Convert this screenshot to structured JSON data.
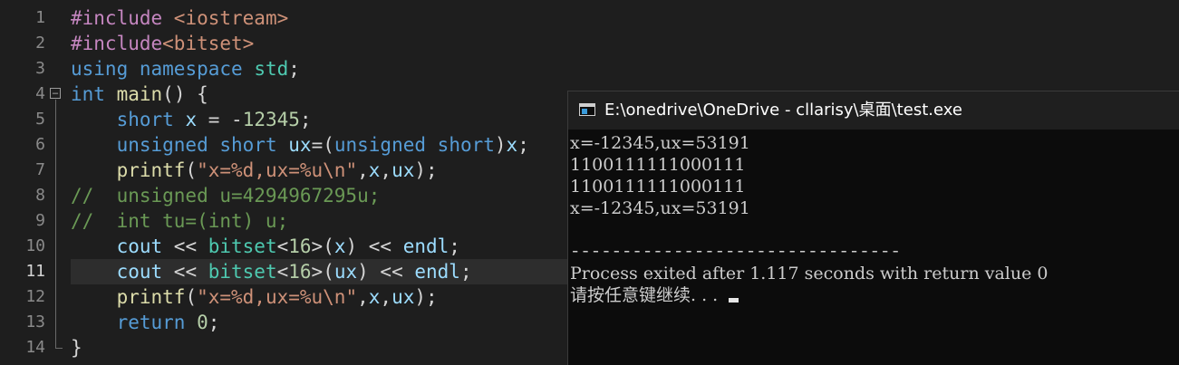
{
  "editor": {
    "line_numbers": [
      "1",
      "2",
      "3",
      "4",
      "5",
      "6",
      "7",
      "8",
      "9",
      "10",
      "11",
      "12",
      "13",
      "14"
    ],
    "fold_marker": "−",
    "lines": [
      [
        {
          "t": "#include ",
          "c": "pp"
        },
        {
          "t": "<iostream>",
          "c": "str"
        }
      ],
      [
        {
          "t": "#include",
          "c": "pp"
        },
        {
          "t": "<bitset>",
          "c": "str"
        }
      ],
      [
        {
          "t": "using",
          "c": "kw"
        },
        {
          "t": " ",
          "c": "op"
        },
        {
          "t": "namespace",
          "c": "kw"
        },
        {
          "t": " ",
          "c": "op"
        },
        {
          "t": "std",
          "c": "ty"
        },
        {
          "t": ";",
          "c": "op"
        }
      ],
      [
        {
          "t": "int",
          "c": "kw"
        },
        {
          "t": " ",
          "c": "op"
        },
        {
          "t": "main",
          "c": "fn"
        },
        {
          "t": "() {",
          "c": "op"
        }
      ],
      [
        {
          "t": "    ",
          "c": "op"
        },
        {
          "t": "short",
          "c": "kw"
        },
        {
          "t": " ",
          "c": "op"
        },
        {
          "t": "x",
          "c": "id"
        },
        {
          "t": " = -",
          "c": "op"
        },
        {
          "t": "12345",
          "c": "num"
        },
        {
          "t": ";",
          "c": "op"
        }
      ],
      [
        {
          "t": "    ",
          "c": "op"
        },
        {
          "t": "unsigned",
          "c": "kw"
        },
        {
          "t": " ",
          "c": "op"
        },
        {
          "t": "short",
          "c": "kw"
        },
        {
          "t": " ",
          "c": "op"
        },
        {
          "t": "ux",
          "c": "id"
        },
        {
          "t": "=(",
          "c": "op"
        },
        {
          "t": "unsigned",
          "c": "kw"
        },
        {
          "t": " ",
          "c": "op"
        },
        {
          "t": "short",
          "c": "kw"
        },
        {
          "t": ")",
          "c": "op"
        },
        {
          "t": "x",
          "c": "id"
        },
        {
          "t": ";",
          "c": "op"
        }
      ],
      [
        {
          "t": "    ",
          "c": "op"
        },
        {
          "t": "printf",
          "c": "fn"
        },
        {
          "t": "(",
          "c": "op"
        },
        {
          "t": "\"x=%d,ux=%u\\n\"",
          "c": "str"
        },
        {
          "t": ",",
          "c": "op"
        },
        {
          "t": "x",
          "c": "id"
        },
        {
          "t": ",",
          "c": "op"
        },
        {
          "t": "ux",
          "c": "id"
        },
        {
          "t": ");",
          "c": "op"
        }
      ],
      [
        {
          "t": "//  unsigned u=4294967295u;",
          "c": "cm"
        }
      ],
      [
        {
          "t": "//  int tu=(int) u;",
          "c": "cm"
        }
      ],
      [
        {
          "t": "    ",
          "c": "op"
        },
        {
          "t": "cout",
          "c": "id"
        },
        {
          "t": " << ",
          "c": "op"
        },
        {
          "t": "bitset",
          "c": "ty"
        },
        {
          "t": "<",
          "c": "op"
        },
        {
          "t": "16",
          "c": "num"
        },
        {
          "t": ">(",
          "c": "op"
        },
        {
          "t": "x",
          "c": "id"
        },
        {
          "t": ") << ",
          "c": "op"
        },
        {
          "t": "endl",
          "c": "id"
        },
        {
          "t": ";",
          "c": "op"
        }
      ],
      [
        {
          "t": "    ",
          "c": "op"
        },
        {
          "t": "cout",
          "c": "id"
        },
        {
          "t": " << ",
          "c": "op"
        },
        {
          "t": "bitset",
          "c": "ty"
        },
        {
          "t": "<",
          "c": "op"
        },
        {
          "t": "16",
          "c": "num"
        },
        {
          "t": ">(",
          "c": "op"
        },
        {
          "t": "ux",
          "c": "id"
        },
        {
          "t": ") << ",
          "c": "op"
        },
        {
          "t": "endl",
          "c": "id"
        },
        {
          "t": ";",
          "c": "op"
        }
      ],
      [
        {
          "t": "    ",
          "c": "op"
        },
        {
          "t": "printf",
          "c": "fn"
        },
        {
          "t": "(",
          "c": "op"
        },
        {
          "t": "\"x=%d,ux=%u\\n\"",
          "c": "str"
        },
        {
          "t": ",",
          "c": "op"
        },
        {
          "t": "x",
          "c": "id"
        },
        {
          "t": ",",
          "c": "op"
        },
        {
          "t": "ux",
          "c": "id"
        },
        {
          "t": ");",
          "c": "op"
        }
      ],
      [
        {
          "t": "    ",
          "c": "op"
        },
        {
          "t": "return",
          "c": "kw"
        },
        {
          "t": " ",
          "c": "op"
        },
        {
          "t": "0",
          "c": "num"
        },
        {
          "t": ";",
          "c": "op"
        }
      ],
      [
        {
          "t": "}",
          "c": "op"
        }
      ]
    ],
    "highlighted_line": 11
  },
  "console": {
    "title": "E:\\onedrive\\OneDrive - cllarisy\\桌面\\test.exe",
    "output": [
      "x=-12345,ux=53191",
      "1100111111000111",
      "1100111111000111",
      "x=-12345,ux=53191",
      "",
      "--------------------------------",
      "Process exited after 1.117 seconds with return value 0",
      "请按任意键继续. . . "
    ]
  },
  "colors": {
    "editor_bg": "#1e1e1e",
    "console_bg": "#0c0c0c",
    "keyword": "#569cd6",
    "string": "#ce9178",
    "comment": "#6a9955",
    "number": "#b5cea8"
  }
}
